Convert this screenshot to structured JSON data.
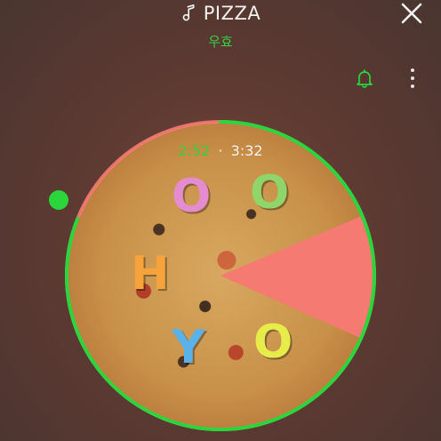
{
  "header": {
    "title": "PIZZA",
    "subtitle": "우효",
    "close_icon": "close-icon",
    "music_icon": "music-note-icon"
  },
  "actions": {
    "bell_icon": "bell-icon",
    "more_icon": "more-vertical-icon"
  },
  "player": {
    "elapsed": "2:52",
    "separator": "·",
    "total": "3:32",
    "progress_fraction": 0.81,
    "artwork_letters": [
      "O",
      "O",
      "H",
      "Y",
      "O"
    ]
  },
  "colors": {
    "accent_green": "#2ad63c",
    "wedge_pink": "#f47a72",
    "text_light": "#f2f2f2"
  }
}
